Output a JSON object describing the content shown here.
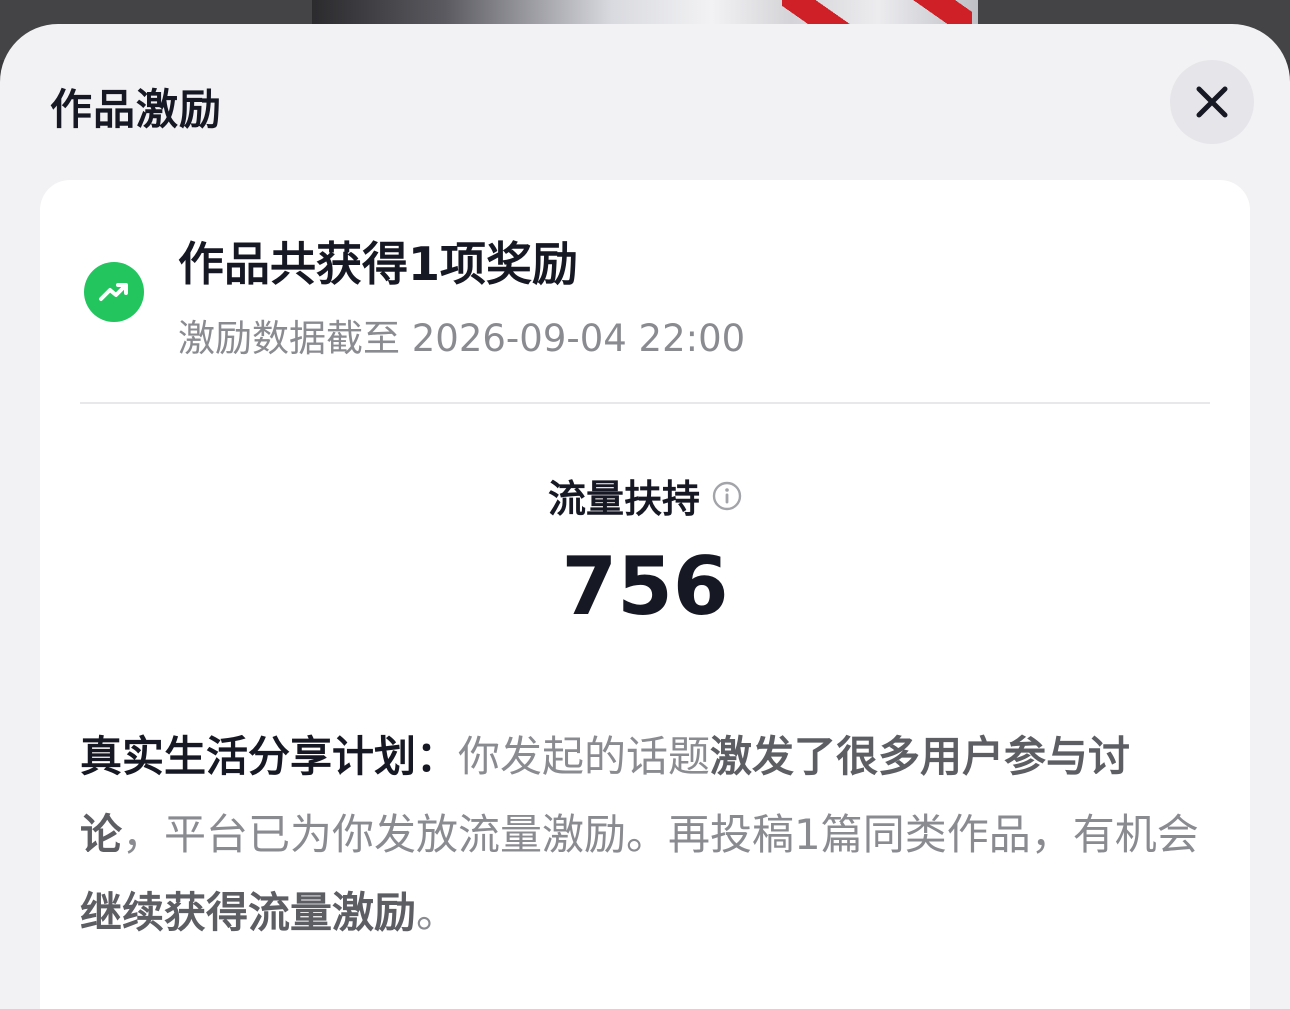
{
  "sheet": {
    "title": "作品激励"
  },
  "summary": {
    "headline": "作品共获得1项奖励",
    "subline": "激励数据截至 2026-09-04 22:00"
  },
  "metric": {
    "label": "流量扶持",
    "value": "756"
  },
  "description": {
    "plan_name": "真实生活分享计划：",
    "part1": "你发起的话题",
    "emph1": "激发了很多用户参与讨论",
    "part2": "，平台已为你发放流量激励。再投稿1篇同类作品，有机会",
    "emph2": "继续获得流量激励",
    "part3": "。"
  },
  "colors": {
    "accent_green": "#22c55e",
    "text_primary": "#161823",
    "text_secondary": "#8a8b91",
    "sheet_bg": "#f2f2f4"
  },
  "icons": {
    "close": "close-icon",
    "trend": "trending-up-icon",
    "info": "info-icon"
  }
}
